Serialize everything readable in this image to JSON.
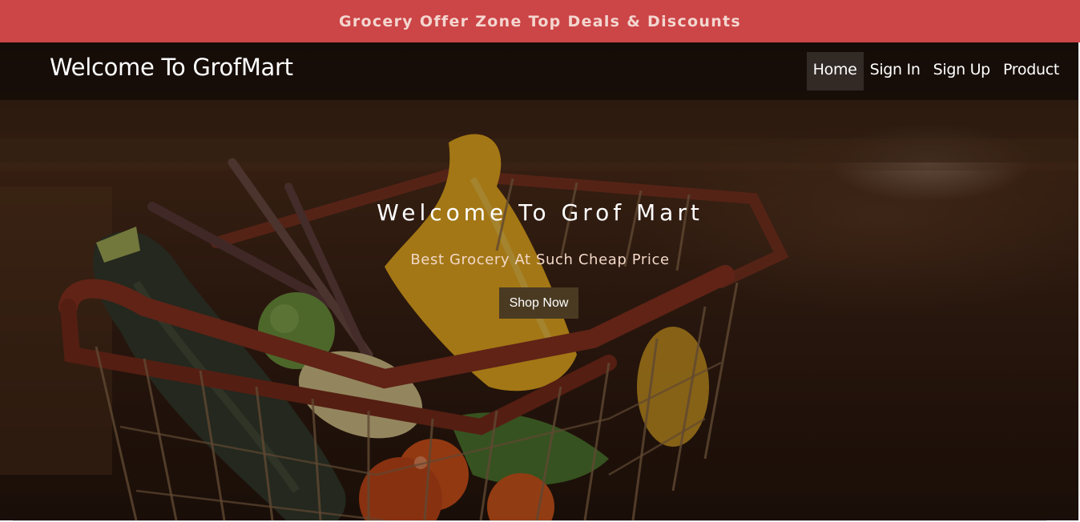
{
  "offer_banner": {
    "text": "Grocery Offer Zone Top Deals & Discounts",
    "color": "#cc4547"
  },
  "navbar": {
    "brand": "Welcome To GrofMart",
    "links": [
      {
        "label": "Home",
        "active": true
      },
      {
        "label": "Sign In",
        "active": false
      },
      {
        "label": "Sign Up",
        "active": false
      },
      {
        "label": "Product",
        "active": false
      }
    ]
  },
  "hero": {
    "title": "Welcome To Grof Mart",
    "subtitle": "Best Grocery At Such Cheap Price",
    "cta_label": "Shop Now",
    "cta_color": "#4a3a22"
  }
}
